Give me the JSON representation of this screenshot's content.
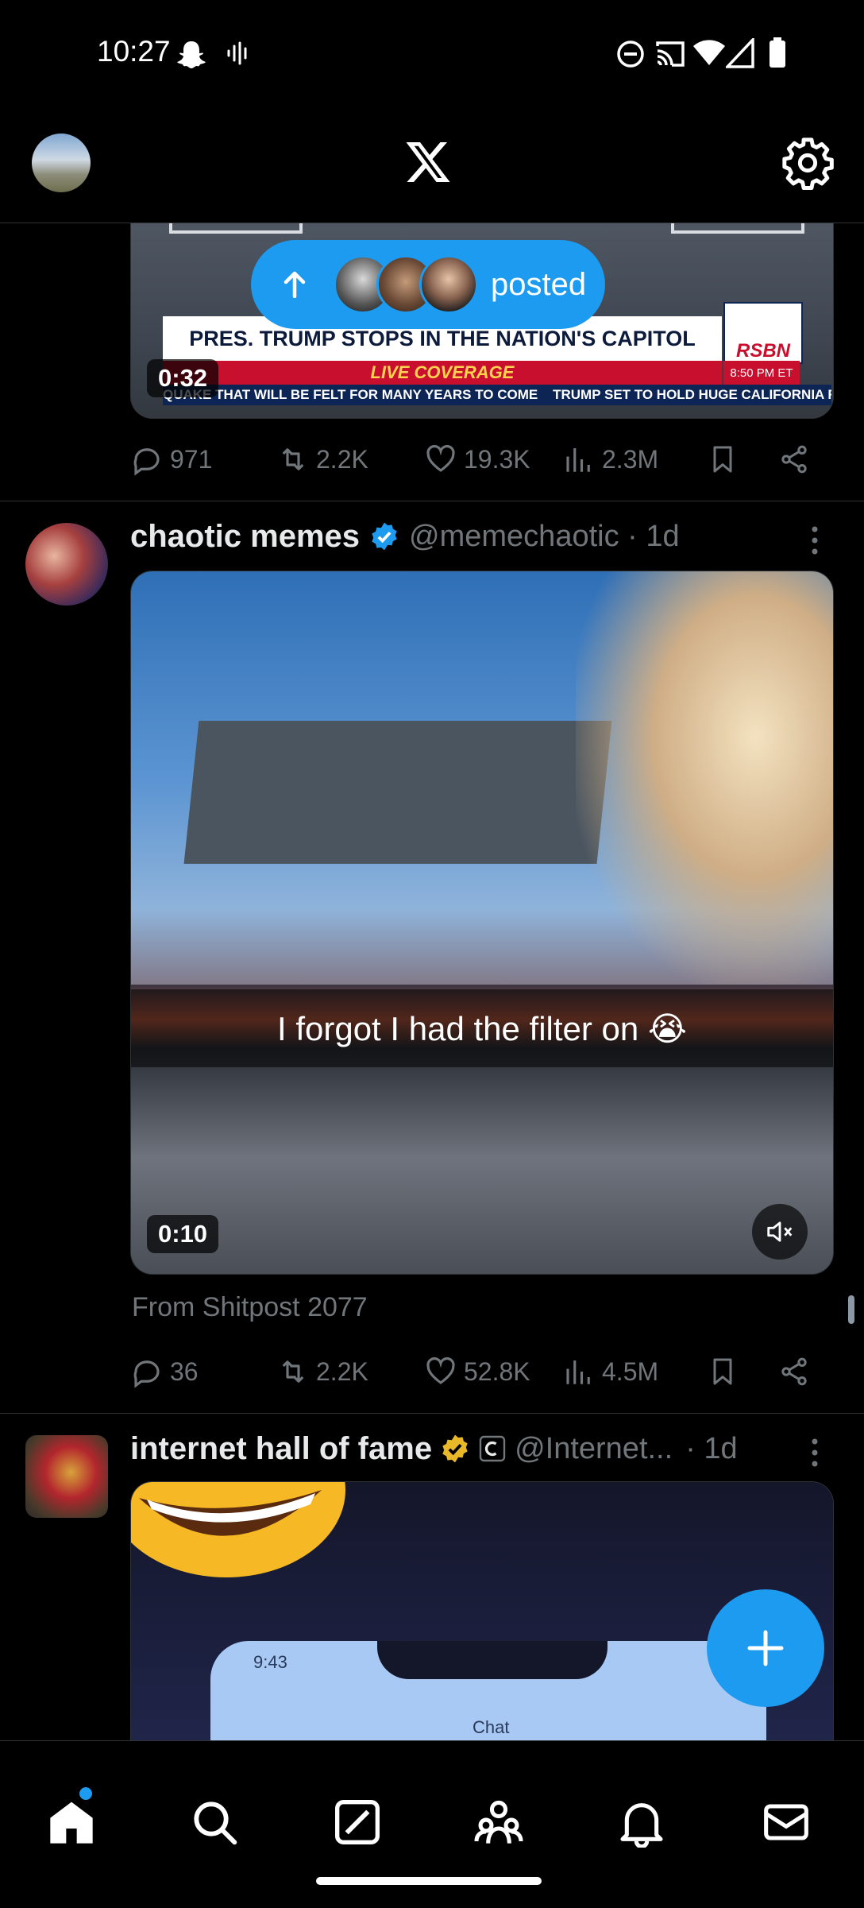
{
  "status_bar": {
    "time": "10:27"
  },
  "header": {
    "logo": "x-logo-icon",
    "settings_icon": "gear-icon"
  },
  "posted_pill": {
    "label": "posted"
  },
  "tweet1": {
    "video": {
      "banner_headline": "PRES. TRUMP STOPS IN THE NATION'S CAPITOL",
      "banner_sub": "LIVE COVERAGE",
      "ticker": "QUAKE THAT WILL BE FELT FOR MANY YEARS TO COME    TRUMP SET TO HOLD HUGE CALIFORNIA R",
      "network": "RSBN",
      "clock": "8:50 PM ET",
      "duration": "0:32"
    },
    "stats": {
      "replies": "971",
      "reposts": "2.2K",
      "likes": "19.3K",
      "views": "2.3M"
    }
  },
  "tweet2": {
    "name": "chaotic memes",
    "handle": "@memechaotic · 1d",
    "video": {
      "caption": "I forgot I had the filter on 😭",
      "duration": "0:10"
    },
    "source": "From Shitpost 2077",
    "stats": {
      "replies": "36",
      "reposts": "2.2K",
      "likes": "52.8K",
      "views": "4.5M"
    }
  },
  "tweet3": {
    "name": "internet hall of fame",
    "handle": "@Internet...",
    "time": "· 1d",
    "media": {
      "phone_time": "9:43",
      "phone_label": "Chat"
    }
  },
  "colors": {
    "accent": "#1d9bf0",
    "background": "#000000",
    "muted": "#71767b",
    "gold_badge": "#e8b829"
  }
}
